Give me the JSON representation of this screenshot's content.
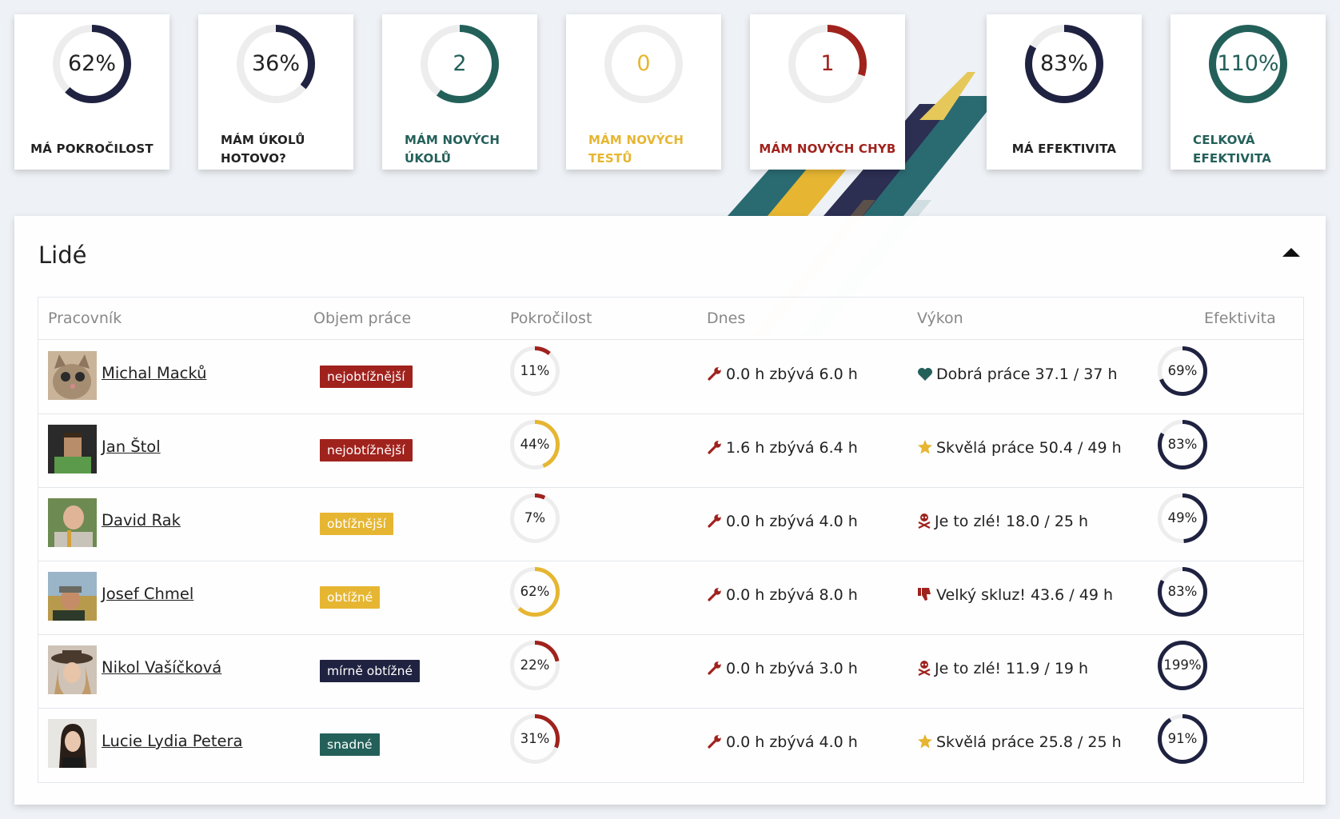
{
  "colors": {
    "navy": "#1f2240",
    "teal": "#24605a",
    "yellow": "#e6b632",
    "red": "#a0221d",
    "ring_track": "#ededed"
  },
  "cards": [
    {
      "value": "62%",
      "label": "MÁ POKROČILOST",
      "progress": 0.62,
      "ring_color": "#1f2240",
      "value_color": "#222222",
      "label_color": "#222222"
    },
    {
      "value": "36%",
      "label": "MÁM ÚKOLŮ HOTOVO?",
      "progress": 0.36,
      "ring_color": "#1f2240",
      "value_color": "#222222",
      "label_color": "#222222"
    },
    {
      "value": "2",
      "label": "MÁM NOVÝCH ÚKOLŮ",
      "progress": 0.6,
      "ring_color": "#24605a",
      "value_color": "#24605a",
      "label_color": "#24605a"
    },
    {
      "value": "0",
      "label": "MÁM NOVÝCH TESTŮ",
      "progress": 0,
      "ring_color": "#e6b632",
      "value_color": "#e6b632",
      "label_color": "#e6b632"
    },
    {
      "value": "1",
      "label": "MÁM NOVÝCH CHYB",
      "progress": 0.3,
      "ring_color": "#a0221d",
      "value_color": "#a0221d",
      "label_color": "#a0221d"
    },
    {
      "value": "83%",
      "label": "MÁ EFEKTIVITA",
      "progress": 0.83,
      "ring_color": "#1f2240",
      "value_color": "#222222",
      "label_color": "#222222"
    },
    {
      "value": "110%",
      "label": "CELKOVÁ EFEKTIVITA",
      "progress": 1.0,
      "ring_color": "#24605a",
      "value_color": "#24605a",
      "label_color": "#24605a"
    }
  ],
  "panel": {
    "title": "Lidé",
    "columns": [
      "Pracovník",
      "Objem práce",
      "Pokročilost",
      "Dnes",
      "Výkon",
      "Efektivita"
    ],
    "rows": [
      {
        "name": "Michal Macků",
        "workload": "nejobtížnější",
        "workload_color": "#a0221d",
        "progress": "11%",
        "progress_value": 0.11,
        "progress_color": "#a0221d",
        "today": "0.0 h zbývá 6.0 h",
        "performance_icon": "heart-icon",
        "performance": "Dobrá práce 37.1 / 37 h",
        "efficiency": "69%",
        "efficiency_value": 0.69,
        "avatar": "cat"
      },
      {
        "name": "Jan Štol",
        "workload": "nejobtížnější",
        "workload_color": "#a0221d",
        "progress": "44%",
        "progress_value": 0.44,
        "progress_color": "#e6b632",
        "today": "1.6 h zbývá 6.4 h",
        "performance_icon": "star-icon",
        "performance": "Skvělá práce 50.4 / 49 h",
        "efficiency": "83%",
        "efficiency_value": 0.83,
        "avatar": "pixel"
      },
      {
        "name": "David Rak",
        "workload": "obtížnější",
        "workload_color": "#e6b632",
        "progress": "7%",
        "progress_value": 0.07,
        "progress_color": "#a0221d",
        "today": "0.0 h zbývá 4.0 h",
        "performance_icon": "skull-icon",
        "performance": "Je to zlé! 18.0 / 25 h",
        "efficiency": "49%",
        "efficiency_value": 0.49,
        "avatar": "bald"
      },
      {
        "name": "Josef Chmel",
        "workload": "obtížné",
        "workload_color": "#e6b632",
        "progress": "62%",
        "progress_value": 0.62,
        "progress_color": "#e6b632",
        "today": "0.0 h zbývá 8.0 h",
        "performance_icon": "thumbs-down-icon",
        "performance": "Velký skluz! 43.6 / 49 h",
        "efficiency": "83%",
        "efficiency_value": 0.83,
        "avatar": "field"
      },
      {
        "name": "Nikol Vašíčková",
        "workload": "mírně obtížné",
        "workload_color": "#1f2240",
        "progress": "22%",
        "progress_value": 0.22,
        "progress_color": "#a0221d",
        "today": "0.0 h zbývá 3.0 h",
        "performance_icon": "skull-icon",
        "performance": "Je to zlé! 11.9 / 19 h",
        "efficiency": "199%",
        "efficiency_value": 1.0,
        "avatar": "hat"
      },
      {
        "name": "Lucie Lydia Petera",
        "workload": "snadné",
        "workload_color": "#24605a",
        "progress": "31%",
        "progress_value": 0.31,
        "progress_color": "#a0221d",
        "today": "0.0 h zbývá 4.0 h",
        "performance_icon": "star-icon",
        "performance": "Skvělá práce 25.8 / 25 h",
        "efficiency": "91%",
        "efficiency_value": 0.91,
        "avatar": "dark"
      }
    ]
  }
}
